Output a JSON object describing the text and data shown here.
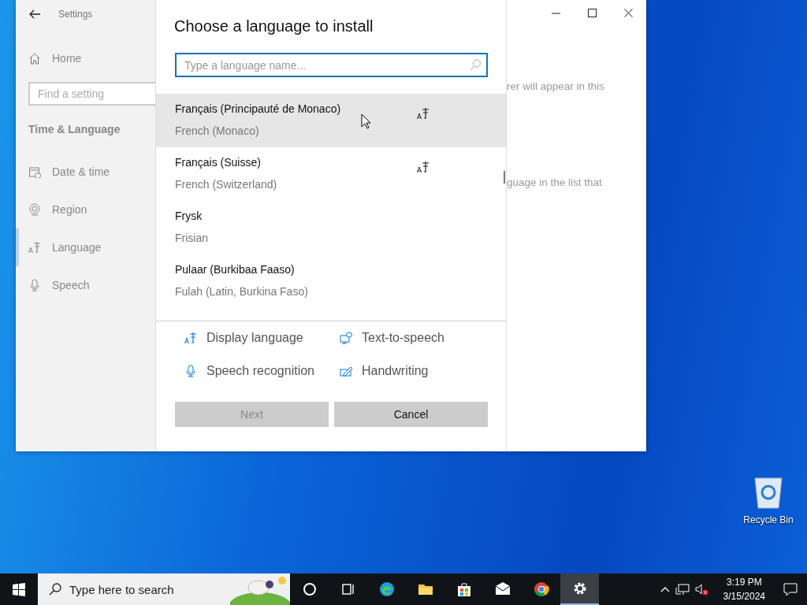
{
  "settings_window": {
    "title": "Settings",
    "home": "Home",
    "search": {
      "placeholder": "Find a setting"
    },
    "section": "Time & Language",
    "items": [
      {
        "label": "Date & time",
        "kind": "calendar",
        "selected": false
      },
      {
        "label": "Region",
        "kind": "globe",
        "selected": false
      },
      {
        "label": "Language",
        "kind": "language",
        "selected": true
      },
      {
        "label": "Speech",
        "kind": "microphone",
        "selected": false
      }
    ],
    "content_fragments": [
      "rer will appear in this",
      "guage in the list that"
    ]
  },
  "dialog": {
    "title": "Choose a language to install",
    "search": {
      "placeholder": "Type a language name..."
    },
    "languages": [
      {
        "name": "Français (Principauté de Monaco)",
        "english": "French (Monaco)",
        "display_language": true,
        "selected": true
      },
      {
        "name": "Français (Suisse)",
        "english": "French (Switzerland)",
        "display_language": true,
        "selected": false
      },
      {
        "name": "Frysk",
        "english": "Frisian",
        "display_language": false,
        "selected": false
      },
      {
        "name": "Pulaar (Burkibaa Faaso)",
        "english": "Fulah (Latin, Burkina Faso)",
        "display_language": false,
        "selected": false
      }
    ],
    "features": [
      {
        "label": "Display language",
        "kind": "language"
      },
      {
        "label": "Text-to-speech",
        "kind": "speech"
      },
      {
        "label": "Speech recognition",
        "kind": "microphone"
      },
      {
        "label": "Handwriting",
        "kind": "pen"
      }
    ],
    "buttons": [
      {
        "label": "Next",
        "disabled": true
      },
      {
        "label": "Cancel",
        "disabled": false
      }
    ]
  },
  "desktop_icons": [
    {
      "label": "Recycle Bin"
    }
  ],
  "taskbar": {
    "search": {
      "placeholder": "Type here to search"
    },
    "apps": [
      {
        "kind": "cortana",
        "active": false
      },
      {
        "kind": "taskview",
        "active": false
      },
      {
        "kind": "edge",
        "active": false
      },
      {
        "kind": "folder",
        "active": false
      },
      {
        "kind": "store",
        "active": false
      },
      {
        "kind": "mail",
        "active": false
      },
      {
        "kind": "chrome",
        "active": false
      },
      {
        "kind": "gear",
        "active": true
      }
    ],
    "clock": {
      "time": "3:19 PM",
      "date": "3/15/2024"
    }
  }
}
